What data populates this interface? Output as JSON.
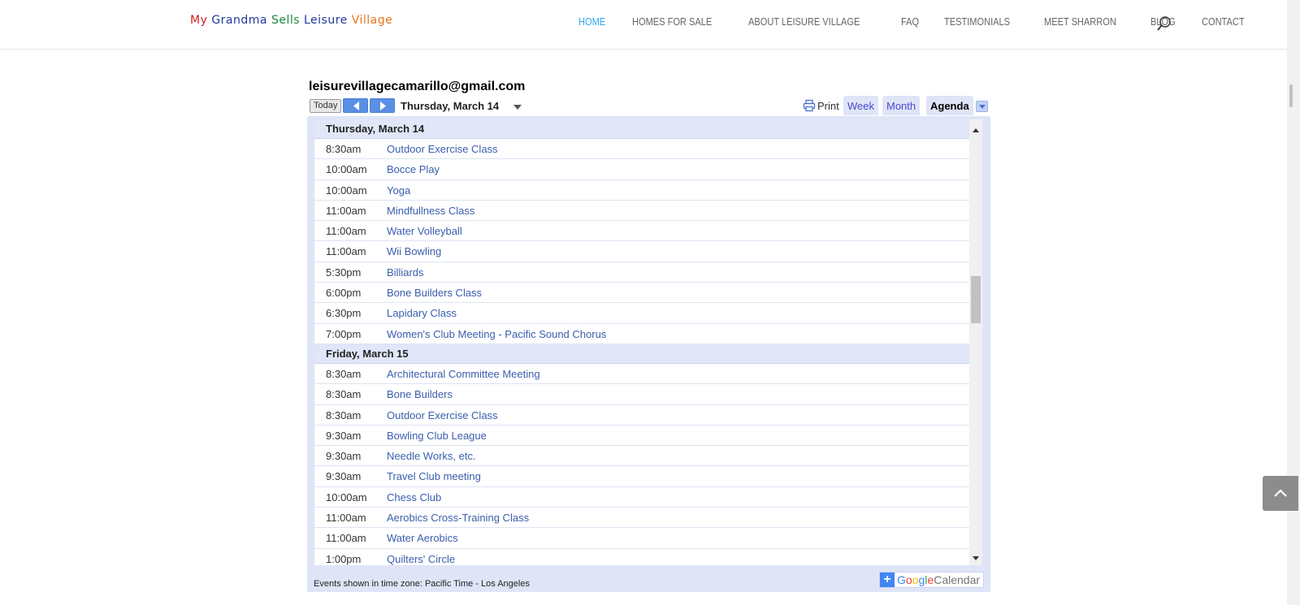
{
  "header": {
    "logo_parts": [
      {
        "text": "My ",
        "color": "#cc1f1f"
      },
      {
        "text": "Grandma ",
        "color": "#1e3a9f"
      },
      {
        "text": "Sells ",
        "color": "#1c8a3a"
      },
      {
        "text": "Leisure ",
        "color": "#1e3a9f"
      },
      {
        "text": "Village",
        "color": "#e8741e"
      }
    ],
    "nav": [
      {
        "label": "HOME",
        "active": true
      },
      {
        "label": "HOMES FOR SALE"
      },
      {
        "label": "ABOUT LEISURE VILLAGE"
      },
      {
        "label": "FAQ"
      },
      {
        "label": "TESTIMONIALS"
      },
      {
        "label": "MEET SHARRON"
      },
      {
        "label": "BLOG"
      },
      {
        "label": "CONTACT"
      }
    ],
    "accent_color": "#2ea3f2"
  },
  "calendar": {
    "title": "leisurevillagecamarillo@gmail.com",
    "today_label": "Today",
    "date_label": "Thursday, March 14",
    "print_label": "Print",
    "tabs": {
      "week": "Week",
      "month": "Month",
      "agenda": "Agenda"
    },
    "days": [
      {
        "header": "Thursday, March 14",
        "events": [
          {
            "time": "8:30am",
            "title": "Outdoor Exercise Class"
          },
          {
            "time": "10:00am",
            "title": "Bocce Play"
          },
          {
            "time": "10:00am",
            "title": "Yoga"
          },
          {
            "time": "11:00am",
            "title": "Mindfullness Class"
          },
          {
            "time": "11:00am",
            "title": "Water Volleyball"
          },
          {
            "time": "11:00am",
            "title": "Wii Bowling"
          },
          {
            "time": "5:30pm",
            "title": "Billiards"
          },
          {
            "time": "6:00pm",
            "title": "Bone Builders Class"
          },
          {
            "time": "6:30pm",
            "title": "Lapidary Class"
          },
          {
            "time": "7:00pm",
            "title": "Women's Club Meeting - Pacific Sound Chorus"
          }
        ]
      },
      {
        "header": "Friday, March 15",
        "events": [
          {
            "time": "8:30am",
            "title": "Architectural Committee Meeting"
          },
          {
            "time": "8:30am",
            "title": "Bone Builders"
          },
          {
            "time": "8:30am",
            "title": "Outdoor Exercise Class"
          },
          {
            "time": "9:30am",
            "title": "Bowling Club League"
          },
          {
            "time": "9:30am",
            "title": "Needle Works, etc."
          },
          {
            "time": "9:30am",
            "title": "Travel Club meeting"
          },
          {
            "time": "10:00am",
            "title": "Chess Club"
          },
          {
            "time": "11:00am",
            "title": "Aerobics Cross-Training Class"
          },
          {
            "time": "11:00am",
            "title": "Water Aerobics"
          },
          {
            "time": "1:00pm",
            "title": "Quilters' Circle"
          }
        ]
      }
    ],
    "timezone_note": "Events shown in time zone: Pacific Time - Los Angeles",
    "badge": {
      "plus": "+",
      "google": "Google",
      "calendar": "Calendar"
    }
  }
}
